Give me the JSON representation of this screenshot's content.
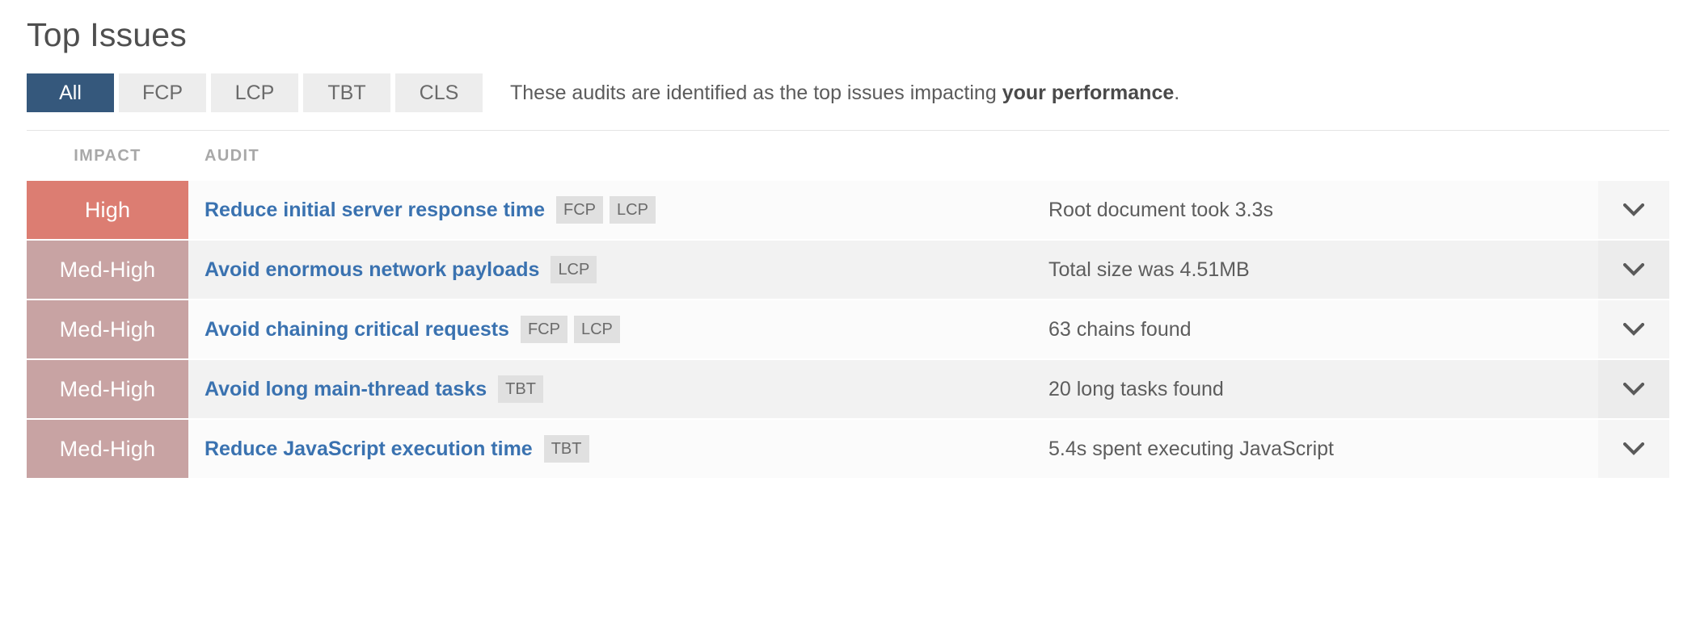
{
  "header": {
    "title": "Top Issues"
  },
  "filters": {
    "tabs": [
      {
        "label": "All",
        "active": true
      },
      {
        "label": "FCP",
        "active": false
      },
      {
        "label": "LCP",
        "active": false
      },
      {
        "label": "TBT",
        "active": false
      },
      {
        "label": "CLS",
        "active": false
      }
    ],
    "description_prefix": "These audits are identified as the top issues impacting ",
    "description_bold": "your performance",
    "description_suffix": "."
  },
  "table": {
    "columns": {
      "impact": "IMPACT",
      "audit": "AUDIT"
    },
    "rows": [
      {
        "impact": "High",
        "impact_color": "#dc7d72",
        "audit": "Reduce initial server response time",
        "metrics": [
          "FCP",
          "LCP"
        ],
        "value": "Root document took 3.3s",
        "expand_icon": "chevron-down-icon"
      },
      {
        "impact": "Med-High",
        "impact_color": "#c8a3a3",
        "audit": "Avoid enormous network payloads",
        "metrics": [
          "LCP"
        ],
        "value": "Total size was 4.51MB",
        "expand_icon": "chevron-down-icon"
      },
      {
        "impact": "Med-High",
        "impact_color": "#c8a3a3",
        "audit": "Avoid chaining critical requests",
        "metrics": [
          "FCP",
          "LCP"
        ],
        "value": "63 chains found",
        "expand_icon": "chevron-down-icon"
      },
      {
        "impact": "Med-High",
        "impact_color": "#c8a3a3",
        "audit": "Avoid long main-thread tasks",
        "metrics": [
          "TBT"
        ],
        "value": "20 long tasks found",
        "expand_icon": "chevron-down-icon"
      },
      {
        "impact": "Med-High",
        "impact_color": "#c8a3a3",
        "audit": "Reduce JavaScript execution time",
        "metrics": [
          "TBT"
        ],
        "value": "5.4s spent executing JavaScript",
        "expand_icon": "chevron-down-icon"
      }
    ]
  },
  "colors": {
    "accent_active_tab": "#35587c",
    "link": "#3a72b0",
    "impact_high": "#dc7d72",
    "impact_med_high": "#c8a3a3",
    "badge_bg": "#e0e0e0",
    "row_bg": "#fbfbfb",
    "row_bg_alt": "#f2f2f2"
  }
}
